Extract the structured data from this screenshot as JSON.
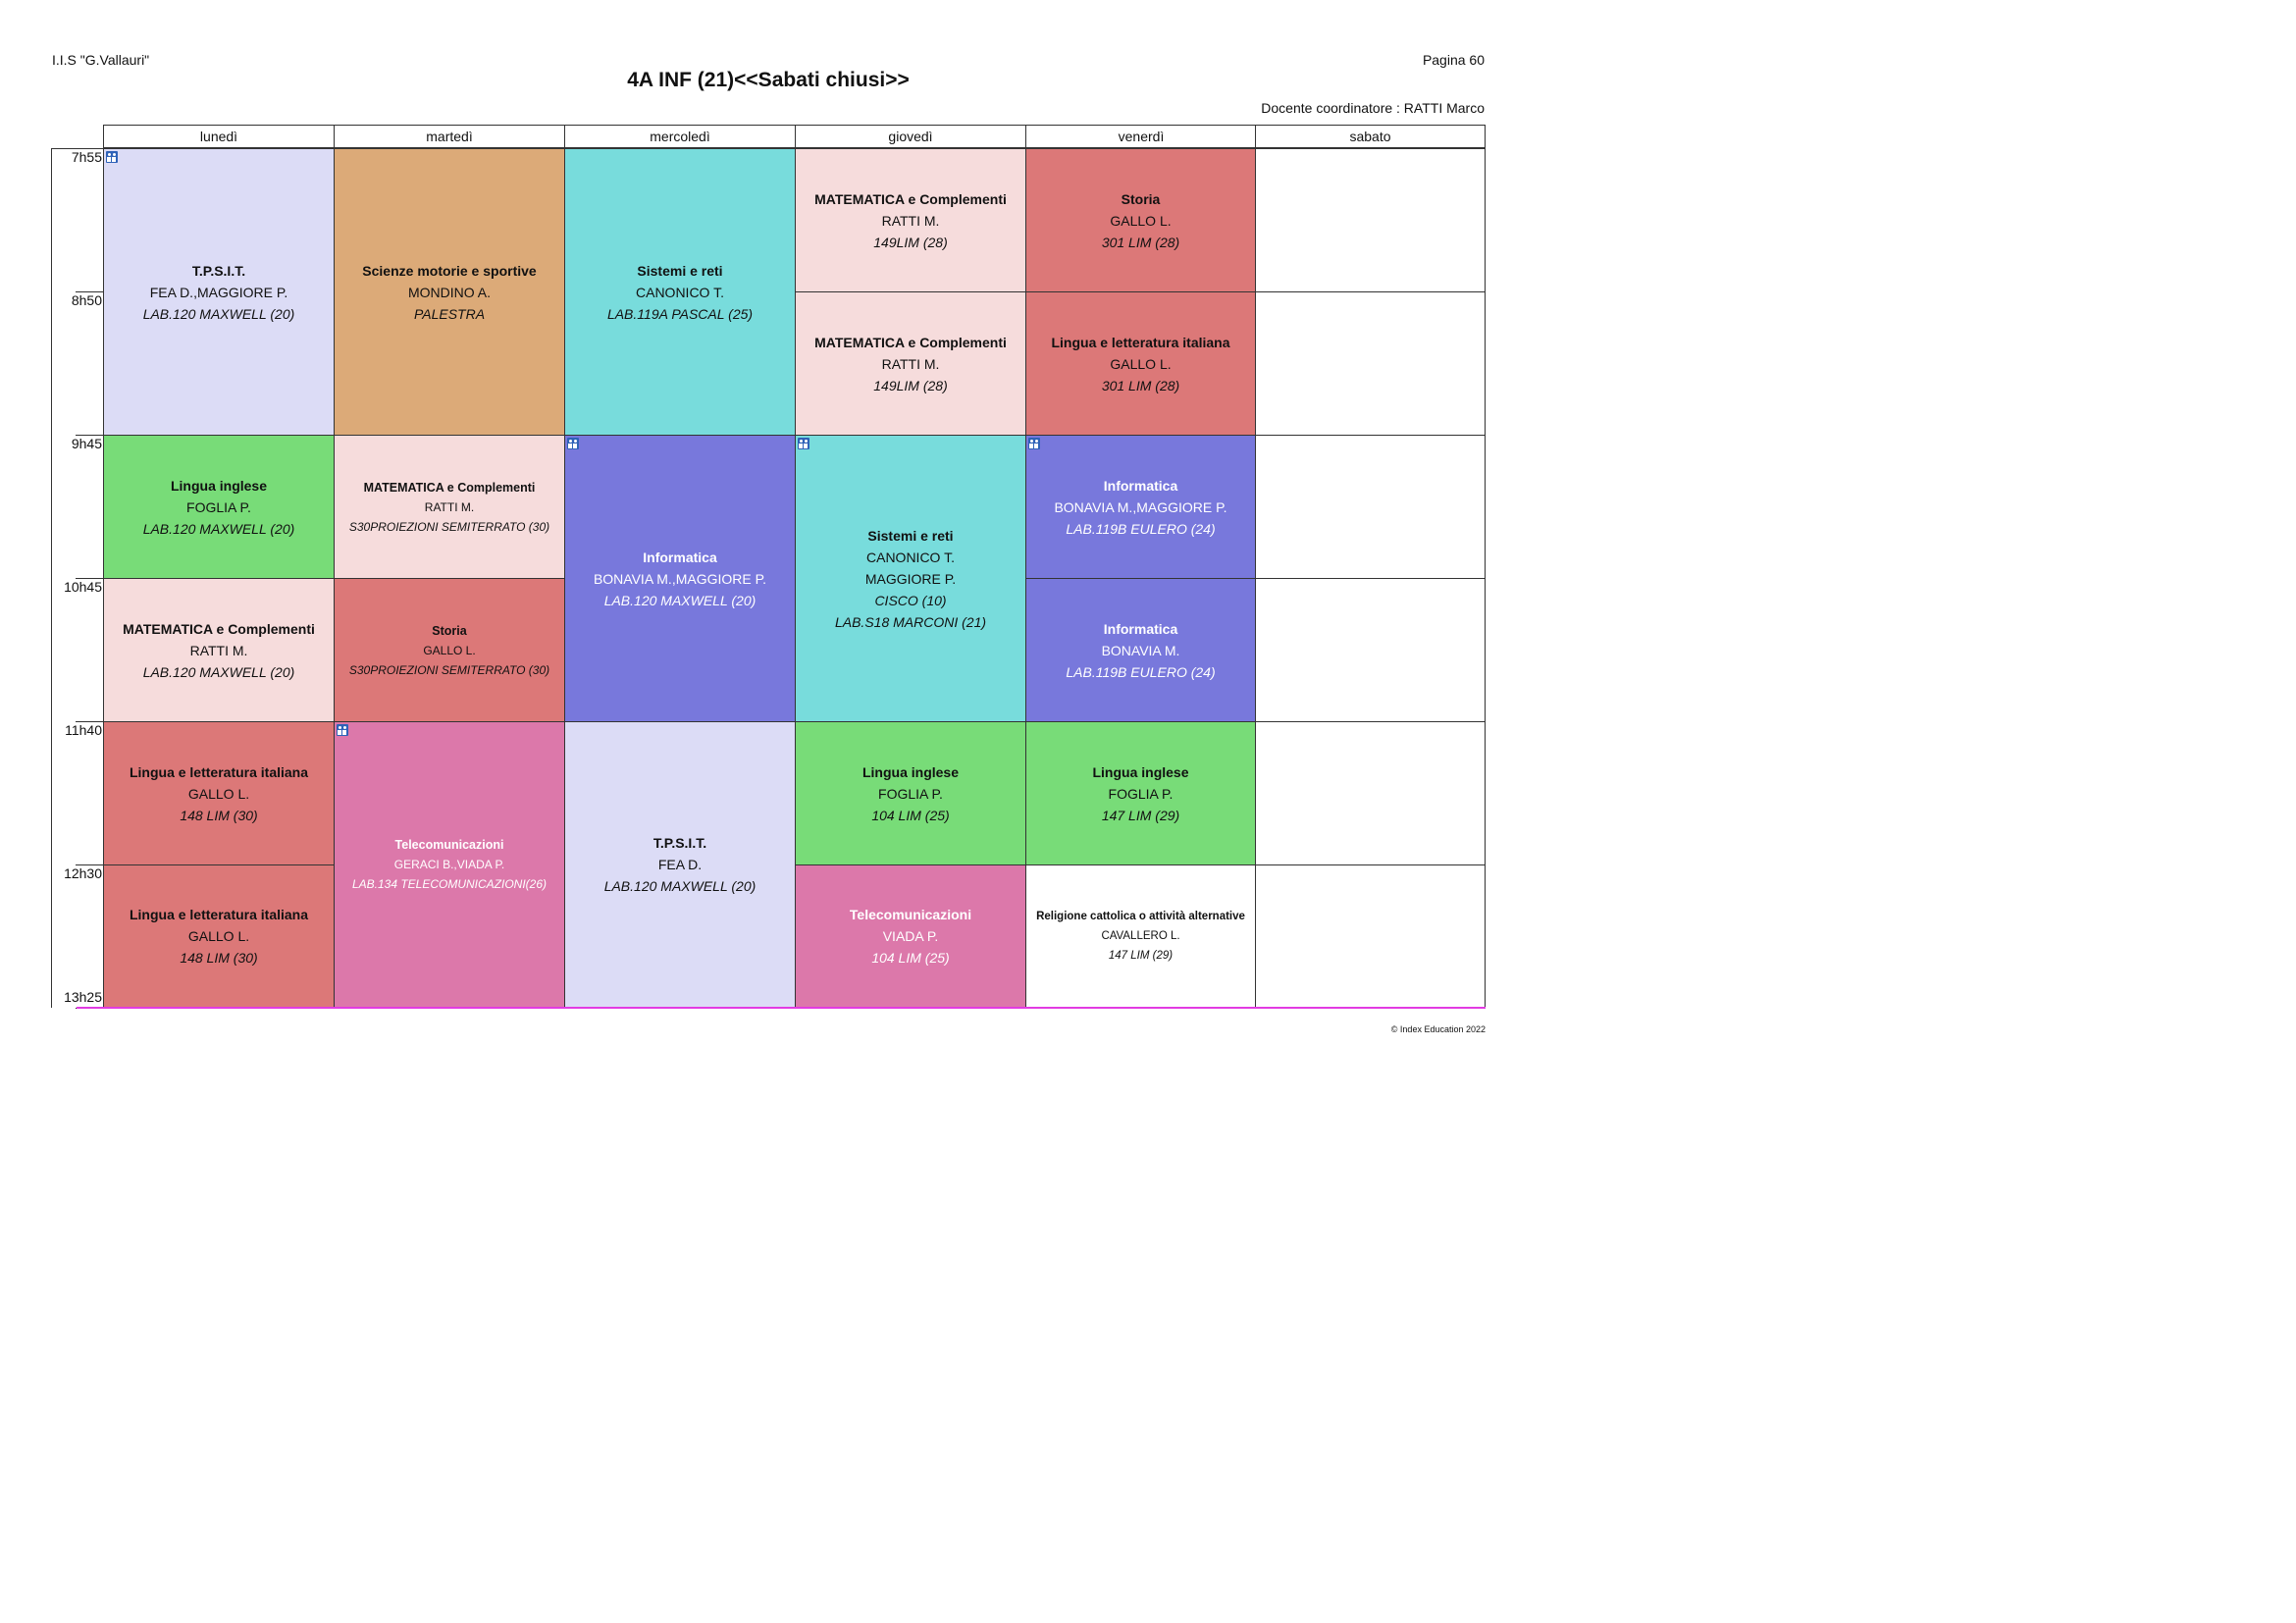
{
  "header": {
    "school": "I.I.S \"G.Vallauri\"",
    "page": "Pagina 60",
    "title": "4A INF (21)<<Sabati chiusi>>",
    "coordinator": "Docente coordinatore : RATTI Marco"
  },
  "days": [
    "lunedì",
    "martedì",
    "mercoledì",
    "giovedì",
    "venerdì",
    "sabato"
  ],
  "times": [
    "7h55",
    "8h50",
    "9h45",
    "10h45",
    "11h40",
    "12h30",
    "13h25"
  ],
  "lessons": {
    "mon1": {
      "subject": "T.P.S.I.T.",
      "teacher": "FEA D.,MAGGIORE P.",
      "room": "LAB.120 MAXWELL (20)"
    },
    "mon2": {
      "subject": "Lingua inglese",
      "teacher": "FOGLIA P.",
      "room": "LAB.120 MAXWELL (20)"
    },
    "mon3": {
      "subject": "MATEMATICA e Complementi",
      "teacher": "RATTI M.",
      "room": "LAB.120 MAXWELL (20)"
    },
    "mon4": {
      "subject": "Lingua e letteratura italiana",
      "teacher": "GALLO L.",
      "room": "148 LIM (30)"
    },
    "mon5": {
      "subject": "Lingua e letteratura italiana",
      "teacher": "GALLO L.",
      "room": "148 LIM (30)"
    },
    "tue1": {
      "subject": "Scienze motorie e sportive",
      "teacher": "MONDINO A.",
      "room": "PALESTRA"
    },
    "tue2": {
      "subject": "MATEMATICA e Complementi",
      "teacher": "RATTI M.",
      "room": "S30PROIEZIONI SEMITERRATO (30)"
    },
    "tue3": {
      "subject": "Storia",
      "teacher": "GALLO L.",
      "room": "S30PROIEZIONI SEMITERRATO (30)"
    },
    "tue4": {
      "subject": "Telecomunicazioni",
      "teacher": "GERACI B.,VIADA P.",
      "room": "LAB.134 TELECOMUNICAZIONI(26)"
    },
    "wed1": {
      "subject": "Sistemi e reti",
      "teacher": "CANONICO T.",
      "room": "LAB.119A PASCAL (25)"
    },
    "wed2": {
      "subject": "Informatica",
      "teacher": "BONAVIA M.,MAGGIORE P.",
      "room": "LAB.120 MAXWELL (20)"
    },
    "wed3": {
      "subject": "T.P.S.I.T.",
      "teacher": "FEA D.",
      "room": "LAB.120 MAXWELL (20)"
    },
    "thu1": {
      "subject": "MATEMATICA e Complementi",
      "teacher": "RATTI M.",
      "room": "149LIM (28)"
    },
    "thu2": {
      "subject": "MATEMATICA e Complementi",
      "teacher": "RATTI M.",
      "room": "149LIM (28)"
    },
    "thu3": {
      "subject": "Sistemi e reti",
      "teacher": "CANONICO T.",
      "teacher2": "MAGGIORE P.",
      "room": "CISCO (10)",
      "room2": "LAB.S18 MARCONI (21)"
    },
    "thu4": {
      "subject": "Lingua inglese",
      "teacher": "FOGLIA P.",
      "room": "104 LIM (25)"
    },
    "thu5": {
      "subject": "Telecomunicazioni",
      "teacher": "VIADA P.",
      "room": "104 LIM (25)"
    },
    "fri1": {
      "subject": "Storia",
      "teacher": "GALLO L.",
      "room": "301 LIM (28)"
    },
    "fri2": {
      "subject": "Lingua e letteratura italiana",
      "teacher": "GALLO L.",
      "room": "301 LIM (28)"
    },
    "fri3": {
      "subject": "Informatica",
      "teacher": "BONAVIA M.,MAGGIORE P.",
      "room": "LAB.119B EULERO (24)"
    },
    "fri4": {
      "subject": "Informatica",
      "teacher": "BONAVIA M.",
      "room": "LAB.119B EULERO (24)"
    },
    "fri5": {
      "subject": "Lingua inglese",
      "teacher": "FOGLIA P.",
      "room": "147 LIM (29)"
    },
    "fri6": {
      "subject": "Religione cattolica o attività alternative",
      "teacher": "CAVALLERO L.",
      "room": "147 LIM (29)"
    }
  },
  "colors": {
    "tpsit": "#dcdcf6",
    "motorie": "#dcaa78",
    "sistemi": "#78dcdc",
    "matematica": "#f6dcdc",
    "italiano_storia": "#dc7878",
    "inglese": "#78dc78",
    "informatica": "#7878dc",
    "telecom": "#dc78aa",
    "religione": "#ffffff",
    "bottom_line": "#e23be2"
  },
  "icons": {
    "group": "group-icon"
  },
  "footer": {
    "copyright": "© Index Education 2022"
  }
}
